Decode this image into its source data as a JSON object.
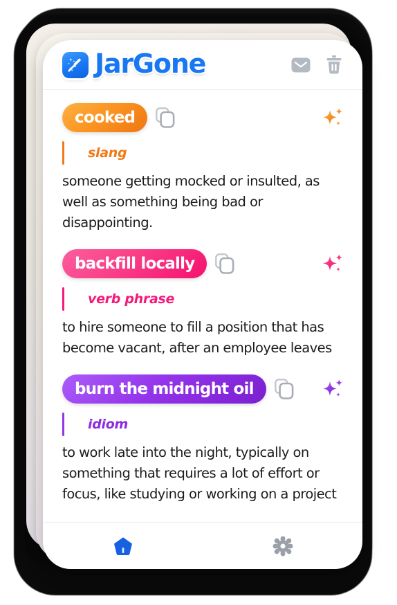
{
  "app": {
    "name": "JarGone",
    "logo_icon": "broom-sparkle-icon",
    "brand_color": "#1877f2"
  },
  "header": {
    "mail_icon": "mail-icon",
    "trash_icon": "trash-icon"
  },
  "entries": [
    {
      "term": "cooked",
      "part_of_speech": "slang",
      "definition": "someone getting mocked or insulted, as well as something being bad or disappointing.",
      "color": "#f07a17",
      "copy_icon": "copy-icon",
      "sparkle_icon": "sparkles-icon"
    },
    {
      "term": "backfill locally",
      "part_of_speech": "verb phrase",
      "definition": "to hire someone to fill a position that has become vacant, after an employee leaves",
      "color": "#f5197a",
      "copy_icon": "copy-icon",
      "sparkle_icon": "sparkles-icon"
    },
    {
      "term": "burn the midnight oil",
      "part_of_speech": "idiom",
      "definition": "to work late into the night, typically on something that requires a lot of effort or focus, like studying or working on a project",
      "color": "#8b2ce0",
      "copy_icon": "copy-icon",
      "sparkle_icon": "sparkles-icon"
    }
  ],
  "bottom_nav": {
    "home_icon": "home-icon",
    "home_active_color": "#1760e0",
    "settings_icon": "gear-icon",
    "settings_color": "#9aa0a8"
  }
}
